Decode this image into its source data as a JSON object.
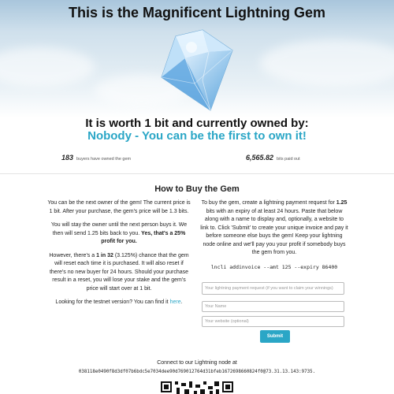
{
  "header": {
    "title": "This is the Magnificent Lightning Gem"
  },
  "status": {
    "worth": "It is worth 1 bit and currently owned by:",
    "owner": "Nobody - You can be the first to own it!"
  },
  "stats": {
    "buyers_count": "183",
    "buyers_label": "buyers have owned the gem",
    "bits_paid": "6,565.82",
    "bits_label": "bits paid out"
  },
  "howto": {
    "heading": "How to Buy the Gem",
    "left": {
      "p1": "You can be the next owner of the gem! The current price is 1 bit. After your purchase, the gem's price will be 1.3 bits.",
      "p2_text": "You will stay the owner until the next person buys it. We then will send 1.25 bits back to you.",
      "p2_bold": "Yes, that's a 25% profit for you.",
      "p3_a": "However, there's a",
      "p3_bold": "1 in 32",
      "p3_b": "(3.125%) chance that the gem will reset each time it is purchased. It will also reset if there's no new buyer for 24 hours. Should your purchase result in a reset, you will lose your stake and the gem's price will start over at 1 bit.",
      "p4_text": "Looking for the testnet version? You can find it",
      "p4_link": "here",
      "p4_end": "."
    },
    "right": {
      "p1_a": "To buy the gem, create a lightning payment request for",
      "p1_bold": "1.25",
      "p1_b": "bits with an expiry of at least 24 hours. Paste that below along with a name to display and, optionally, a website to link to. Click 'Submit' to create your unique invoice and pay it before someone else buys the gem! Keep your lightning node online and we'll pay you your profit if somebody buys the gem from you.",
      "command": "lncli addinvoice --amt 125 --expiry 86400"
    }
  },
  "form": {
    "payment_placeholder": "Your lightning payment request (if you want to claim your winnings)",
    "name_placeholder": "Your Name",
    "website_placeholder": "Your website (optional)",
    "submit_label": "Submit"
  },
  "footer": {
    "connect": "Connect to our Lightning node at",
    "node_id": "038118e0490f8d3df07b6bdc5e7034dee90d769012764d31bfeb1672698660824f0@73.31.13.143:9735."
  },
  "colors": {
    "accent": "#2aa6c6",
    "sky_top": "#a9c6dc",
    "gem": "#8ec5ee"
  },
  "icons": {
    "gem": "diamond-gem-icon",
    "qr": "qr-code-icon"
  }
}
